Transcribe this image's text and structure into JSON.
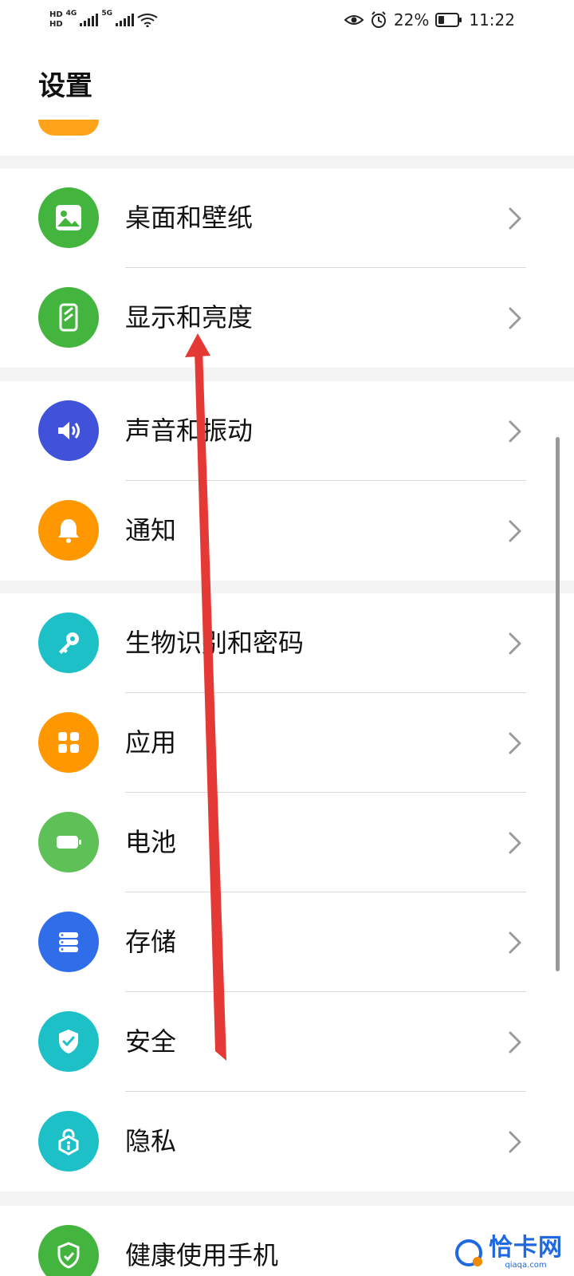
{
  "status_bar": {
    "hd1": "HD",
    "hd2": "HD",
    "net1": "4G",
    "net2": "5G",
    "battery": "22%",
    "time": "11:22"
  },
  "header": {
    "title": "设置"
  },
  "groups": [
    {
      "items": [
        {
          "label": "桌面和壁纸",
          "icon": "image-icon",
          "color": "#43b53f"
        },
        {
          "label": "显示和亮度",
          "icon": "phone-display-icon",
          "color": "#43b53f"
        }
      ]
    },
    {
      "items": [
        {
          "label": "声音和振动",
          "icon": "speaker-icon",
          "color": "#3f52d9"
        },
        {
          "label": "通知",
          "icon": "bell-icon",
          "color": "#ff9800"
        }
      ]
    },
    {
      "items": [
        {
          "label": "生物识别和密码",
          "icon": "key-icon",
          "color": "#1ec0c8"
        },
        {
          "label": "应用",
          "icon": "apps-grid-icon",
          "color": "#ff9800"
        },
        {
          "label": "电池",
          "icon": "battery-icon",
          "color": "#5dc157"
        },
        {
          "label": "存储",
          "icon": "storage-icon",
          "color": "#2f6ee8"
        },
        {
          "label": "安全",
          "icon": "shield-check-icon",
          "color": "#1ec0c8"
        },
        {
          "label": "隐私",
          "icon": "privacy-lock-icon",
          "color": "#1ec0c8"
        }
      ]
    },
    {
      "items": [
        {
          "label": "健康使用手机",
          "icon": "health-phone-icon",
          "color": "#43b53f"
        }
      ]
    }
  ],
  "watermark": {
    "text": "恰卡网",
    "sub": "qiaqa.com"
  },
  "colors": {
    "annotation_arrow": "#e53935",
    "background": "#f4f4f4",
    "card": "#ffffff"
  }
}
